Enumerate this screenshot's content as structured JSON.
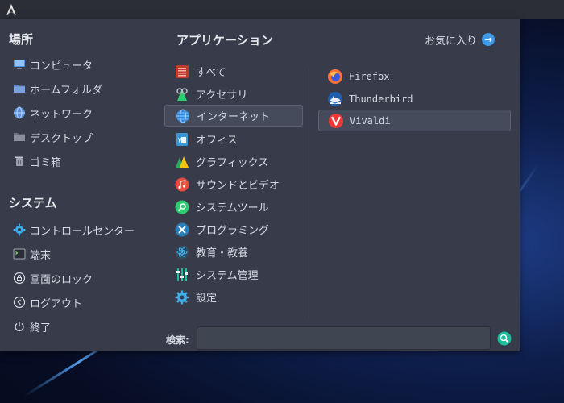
{
  "places": {
    "title": "場所",
    "items": [
      {
        "label": "コンピュータ",
        "icon": "computer-icon"
      },
      {
        "label": "ホームフォルダ",
        "icon": "home-folder-icon"
      },
      {
        "label": "ネットワーク",
        "icon": "network-icon"
      },
      {
        "label": "デスクトップ",
        "icon": "desktop-folder-icon"
      },
      {
        "label": "ゴミ箱",
        "icon": "trash-icon"
      }
    ]
  },
  "system": {
    "title": "システム",
    "items": [
      {
        "label": "コントロールセンター",
        "icon": "control-center-icon"
      },
      {
        "label": "端末",
        "icon": "terminal-icon"
      },
      {
        "label": "画面のロック",
        "icon": "lock-icon"
      },
      {
        "label": "ログアウト",
        "icon": "logout-icon"
      },
      {
        "label": "終了",
        "icon": "power-icon"
      }
    ]
  },
  "applications": {
    "title": "アプリケーション",
    "favorites_label": "お気に入り",
    "categories": [
      {
        "label": "すべて",
        "icon": "all-apps-icon"
      },
      {
        "label": "アクセサリ",
        "icon": "accessories-icon"
      },
      {
        "label": "インターネット",
        "icon": "internet-icon",
        "selected": true
      },
      {
        "label": "オフィス",
        "icon": "office-icon"
      },
      {
        "label": "グラフィックス",
        "icon": "graphics-icon"
      },
      {
        "label": "サウンドとビデオ",
        "icon": "sound-video-icon"
      },
      {
        "label": "システムツール",
        "icon": "system-tools-icon"
      },
      {
        "label": "プログラミング",
        "icon": "programming-icon"
      },
      {
        "label": "教育・教養",
        "icon": "education-icon"
      },
      {
        "label": "システム管理",
        "icon": "system-admin-icon"
      },
      {
        "label": "設定",
        "icon": "settings-icon"
      }
    ],
    "apps": [
      {
        "label": "Firefox",
        "icon": "firefox-icon"
      },
      {
        "label": "Thunderbird",
        "icon": "thunderbird-icon"
      },
      {
        "label": "Vivaldi",
        "icon": "vivaldi-icon",
        "selected": true
      }
    ]
  },
  "search": {
    "label": "検索:",
    "value": "",
    "icon": "search-icon"
  },
  "colors": {
    "menu_bg": "#383c4a",
    "accent": "#3d9ae8",
    "text": "#d3dae3"
  }
}
